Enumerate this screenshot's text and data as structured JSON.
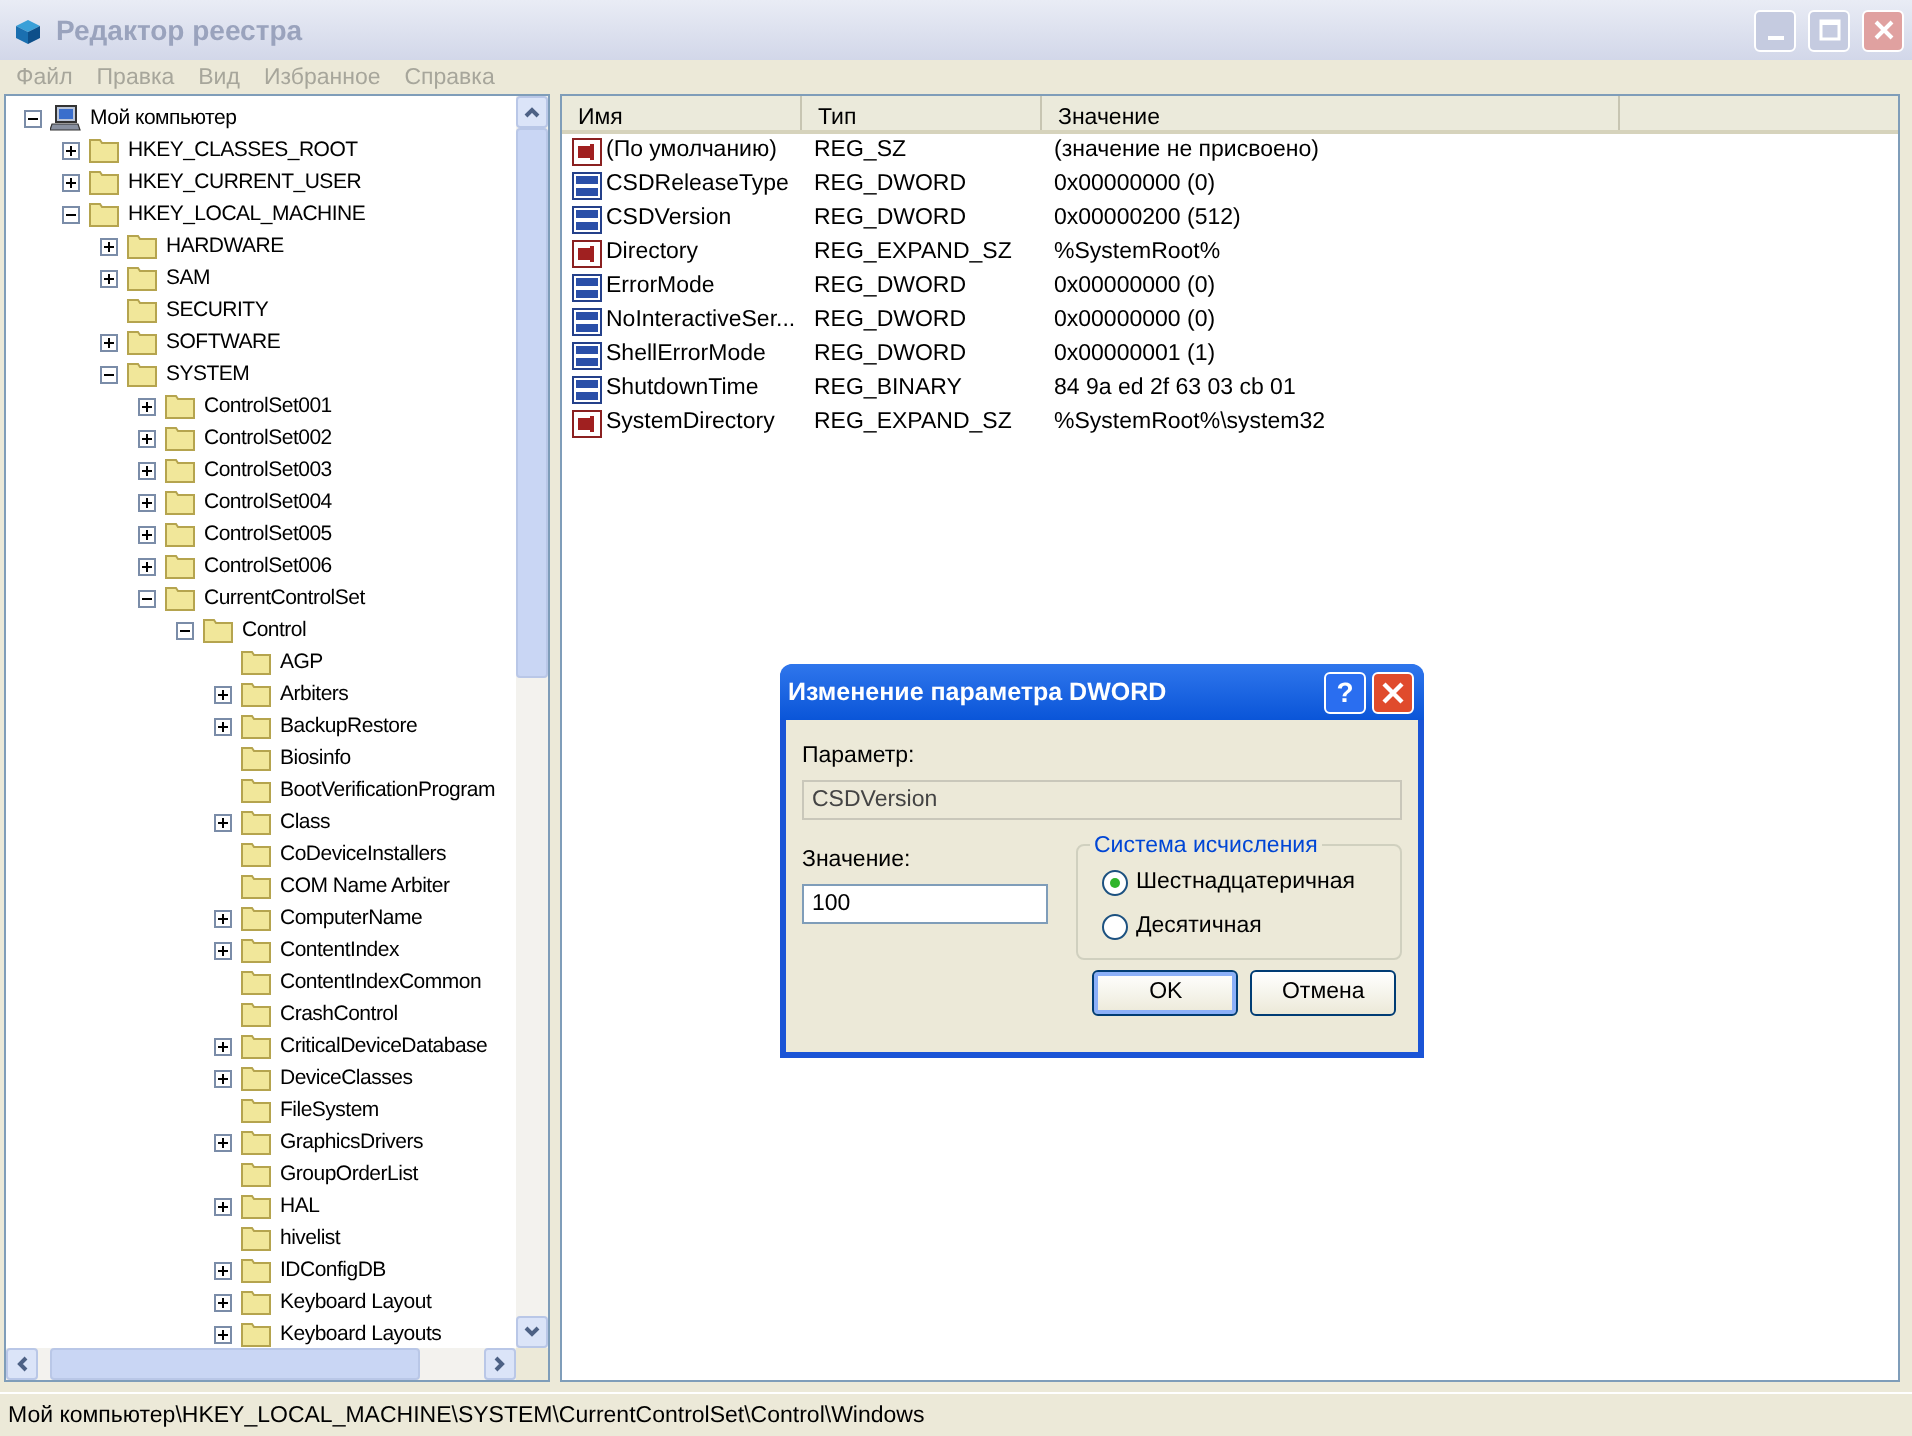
{
  "window": {
    "title": "Редактор реестра",
    "active": false
  },
  "menu": [
    "Файл",
    "Правка",
    "Вид",
    "Избранное",
    "Справка"
  ],
  "tree": [
    {
      "label": "Мой компьютер",
      "kind": "computer",
      "has_children": true,
      "expanded": true,
      "children": [
        {
          "label": "HKEY_CLASSES_ROOT",
          "kind": "folder",
          "has_children": true,
          "expanded": false
        },
        {
          "label": "HKEY_CURRENT_USER",
          "kind": "folder",
          "has_children": true,
          "expanded": false
        },
        {
          "label": "HKEY_LOCAL_MACHINE",
          "kind": "folder",
          "has_children": true,
          "expanded": true,
          "children": [
            {
              "label": "HARDWARE",
              "kind": "folder",
              "has_children": true,
              "expanded": false
            },
            {
              "label": "SAM",
              "kind": "folder",
              "has_children": true,
              "expanded": false
            },
            {
              "label": "SECURITY",
              "kind": "folder",
              "has_children": false
            },
            {
              "label": "SOFTWARE",
              "kind": "folder",
              "has_children": true,
              "expanded": false
            },
            {
              "label": "SYSTEM",
              "kind": "folder",
              "has_children": true,
              "expanded": true,
              "children": [
                {
                  "label": "ControlSet001",
                  "kind": "folder",
                  "has_children": true,
                  "expanded": false
                },
                {
                  "label": "ControlSet002",
                  "kind": "folder",
                  "has_children": true,
                  "expanded": false
                },
                {
                  "label": "ControlSet003",
                  "kind": "folder",
                  "has_children": true,
                  "expanded": false
                },
                {
                  "label": "ControlSet004",
                  "kind": "folder",
                  "has_children": true,
                  "expanded": false
                },
                {
                  "label": "ControlSet005",
                  "kind": "folder",
                  "has_children": true,
                  "expanded": false
                },
                {
                  "label": "ControlSet006",
                  "kind": "folder",
                  "has_children": true,
                  "expanded": false
                },
                {
                  "label": "CurrentControlSet",
                  "kind": "folder",
                  "has_children": true,
                  "expanded": true,
                  "children": [
                    {
                      "label": "Control",
                      "kind": "folder",
                      "has_children": true,
                      "expanded": true,
                      "children": [
                        {
                          "label": "AGP",
                          "kind": "folder",
                          "has_children": false
                        },
                        {
                          "label": "Arbiters",
                          "kind": "folder",
                          "has_children": true,
                          "expanded": false
                        },
                        {
                          "label": "BackupRestore",
                          "kind": "folder",
                          "has_children": true,
                          "expanded": false
                        },
                        {
                          "label": "Biosinfo",
                          "kind": "folder",
                          "has_children": false
                        },
                        {
                          "label": "BootVerificationProgram",
                          "kind": "folder",
                          "has_children": false
                        },
                        {
                          "label": "Class",
                          "kind": "folder",
                          "has_children": true,
                          "expanded": false
                        },
                        {
                          "label": "CoDeviceInstallers",
                          "kind": "folder",
                          "has_children": false
                        },
                        {
                          "label": "COM Name Arbiter",
                          "kind": "folder",
                          "has_children": false
                        },
                        {
                          "label": "ComputerName",
                          "kind": "folder",
                          "has_children": true,
                          "expanded": false
                        },
                        {
                          "label": "ContentIndex",
                          "kind": "folder",
                          "has_children": true,
                          "expanded": false
                        },
                        {
                          "label": "ContentIndexCommon",
                          "kind": "folder",
                          "has_children": false
                        },
                        {
                          "label": "CrashControl",
                          "kind": "folder",
                          "has_children": false
                        },
                        {
                          "label": "CriticalDeviceDatabase",
                          "kind": "folder",
                          "has_children": true,
                          "expanded": false
                        },
                        {
                          "label": "DeviceClasses",
                          "kind": "folder",
                          "has_children": true,
                          "expanded": false
                        },
                        {
                          "label": "FileSystem",
                          "kind": "folder",
                          "has_children": false
                        },
                        {
                          "label": "GraphicsDrivers",
                          "kind": "folder",
                          "has_children": true,
                          "expanded": false
                        },
                        {
                          "label": "GroupOrderList",
                          "kind": "folder",
                          "has_children": false
                        },
                        {
                          "label": "HAL",
                          "kind": "folder",
                          "has_children": true,
                          "expanded": false
                        },
                        {
                          "label": "hivelist",
                          "kind": "folder",
                          "has_children": false
                        },
                        {
                          "label": "IDConfigDB",
                          "kind": "folder",
                          "has_children": true,
                          "expanded": false
                        },
                        {
                          "label": "Keyboard Layout",
                          "kind": "folder",
                          "has_children": true,
                          "expanded": false
                        },
                        {
                          "label": "Keyboard Layouts",
                          "kind": "folder",
                          "has_children": true,
                          "expanded": false
                        }
                      ]
                    }
                  ]
                }
              ]
            }
          ]
        }
      ]
    }
  ],
  "table": {
    "columns": [
      "Имя",
      "Тип",
      "Значение"
    ],
    "rows": [
      {
        "kind": "string",
        "name": "(По умолчанию)",
        "type": "REG_SZ",
        "value": "(значение не присвоено)"
      },
      {
        "kind": "binary",
        "name": "CSDReleaseType",
        "type": "REG_DWORD",
        "value": "0x00000000 (0)"
      },
      {
        "kind": "binary",
        "name": "CSDVersion",
        "type": "REG_DWORD",
        "value": "0x00000200 (512)"
      },
      {
        "kind": "string",
        "name": "Directory",
        "type": "REG_EXPAND_SZ",
        "value": "%SystemRoot%"
      },
      {
        "kind": "binary",
        "name": "ErrorMode",
        "type": "REG_DWORD",
        "value": "0x00000000 (0)"
      },
      {
        "kind": "binary",
        "name": "NoInteractiveSer...",
        "type": "REG_DWORD",
        "value": "0x00000000 (0)"
      },
      {
        "kind": "binary",
        "name": "ShellErrorMode",
        "type": "REG_DWORD",
        "value": "0x00000001 (1)"
      },
      {
        "kind": "binary",
        "name": "ShutdownTime",
        "type": "REG_BINARY",
        "value": "84 9a ed 2f 63 03 cb 01"
      },
      {
        "kind": "string",
        "name": "SystemDirectory",
        "type": "REG_EXPAND_SZ",
        "value": "%SystemRoot%\\system32"
      }
    ]
  },
  "dialog": {
    "title": "Изменение параметра DWORD",
    "help": "?",
    "parameter_label": "Параметр:",
    "parameter_value": "CSDVersion",
    "value_label": "Значение:",
    "value": "100",
    "base_group": "Система исчисления",
    "bases": [
      {
        "label": "Шестнадцатеричная",
        "selected": true
      },
      {
        "label": "Десятичная",
        "selected": false
      }
    ],
    "buttons": [
      "OK",
      "Отмена"
    ]
  },
  "status_bar": "Мой компьютер\\HKEY_LOCAL_MACHINE\\SYSTEM\\CurrentControlSet\\Control\\Windows"
}
